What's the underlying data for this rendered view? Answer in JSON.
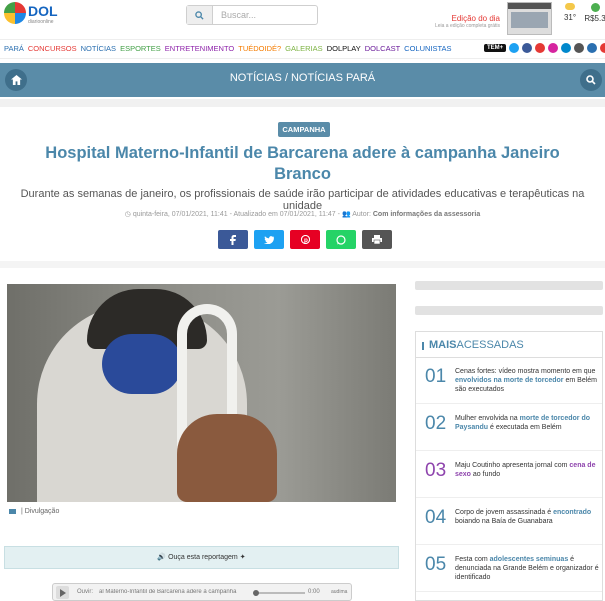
{
  "header": {
    "logo_text": "DOL",
    "logo_sub": "diarioonline",
    "search_placeholder": "Buscar...",
    "edicao_label": "Edição do dia",
    "edicao_sub": "Leia a edição completa grátis",
    "temperature": "31°",
    "currency": "R$5.3"
  },
  "nav": {
    "items": [
      {
        "label": "PARÁ",
        "color": "#2a6fb0"
      },
      {
        "label": "CONCURSOS",
        "color": "#e53935"
      },
      {
        "label": "NOTÍCIAS",
        "color": "#2a6fb0"
      },
      {
        "label": "ESPORTES",
        "color": "#43a047"
      },
      {
        "label": "ENTRETENIMENTO",
        "color": "#8e24aa"
      },
      {
        "label": "TUÉDOIDÉ?",
        "color": "#f57c00"
      },
      {
        "label": "GALERIAS",
        "color": "#7cb342"
      },
      {
        "label": "DOLPLAY",
        "color": "#111111"
      },
      {
        "label": "DOLCAST",
        "color": "#6a1b9a"
      },
      {
        "label": "COLUNISTAS",
        "color": "#1565c0"
      }
    ],
    "tem_label": "TEM+"
  },
  "section": {
    "title": "NOTÍCIAS / NOTÍCIAS PARÁ"
  },
  "article": {
    "tag": "CAMPANHA",
    "title": "Hospital Materno-Infantil de Barcarena adere à campanha Janeiro Branco",
    "subtitle": "Durante as semanas de janeiro, os profissionais de saúde irão participar de atividades educativas e terapêuticas na unidade",
    "meta_date": "quinta-feira, 07/01/2021, 11:41 - Atualizado em 07/01/2021, 11:47 -",
    "meta_author_label": "Autor:",
    "meta_author": "Com informações da assessoria",
    "photo_caption": "| Divulgação",
    "listen_label": "Ouça esta reportagem",
    "audio_label": "Ouvir:",
    "audio_title": "al Materno-Infantil de Barcarena adere à campanha",
    "audio_time": "0:00",
    "audio_brand": "audima"
  },
  "sidebar": {
    "mais_prefix": "MAIS",
    "mais_suffix": "ACESSADAS",
    "items": [
      {
        "num": "01",
        "pre": "Cenas fortes: vídeo mostra momento em que ",
        "hl": "envolvidos na morte de torcedor",
        "post": " em Belém são executados",
        "color": "#4b87aa"
      },
      {
        "num": "02",
        "pre": "Mulher envolvida na ",
        "hl": "morte de torcedor do Paysandu",
        "post": " é executada em Belém",
        "color": "#4b87aa"
      },
      {
        "num": "03",
        "pre": "Maju Coutinho apresenta jornal com ",
        "hl": "cena de sexo",
        "post": " ao fundo",
        "color": "#8e44ad"
      },
      {
        "num": "04",
        "pre": "Corpo de jovem assassinada é ",
        "hl": "encontrado",
        "post": " boiando na Baía de Guanabara",
        "color": "#4b87aa"
      },
      {
        "num": "05",
        "pre": "Festa com ",
        "hl": "adolescentes seminuas",
        "post": " é denunciada na Grande Belém e organizador é identificado",
        "color": "#4b87aa"
      }
    ]
  }
}
